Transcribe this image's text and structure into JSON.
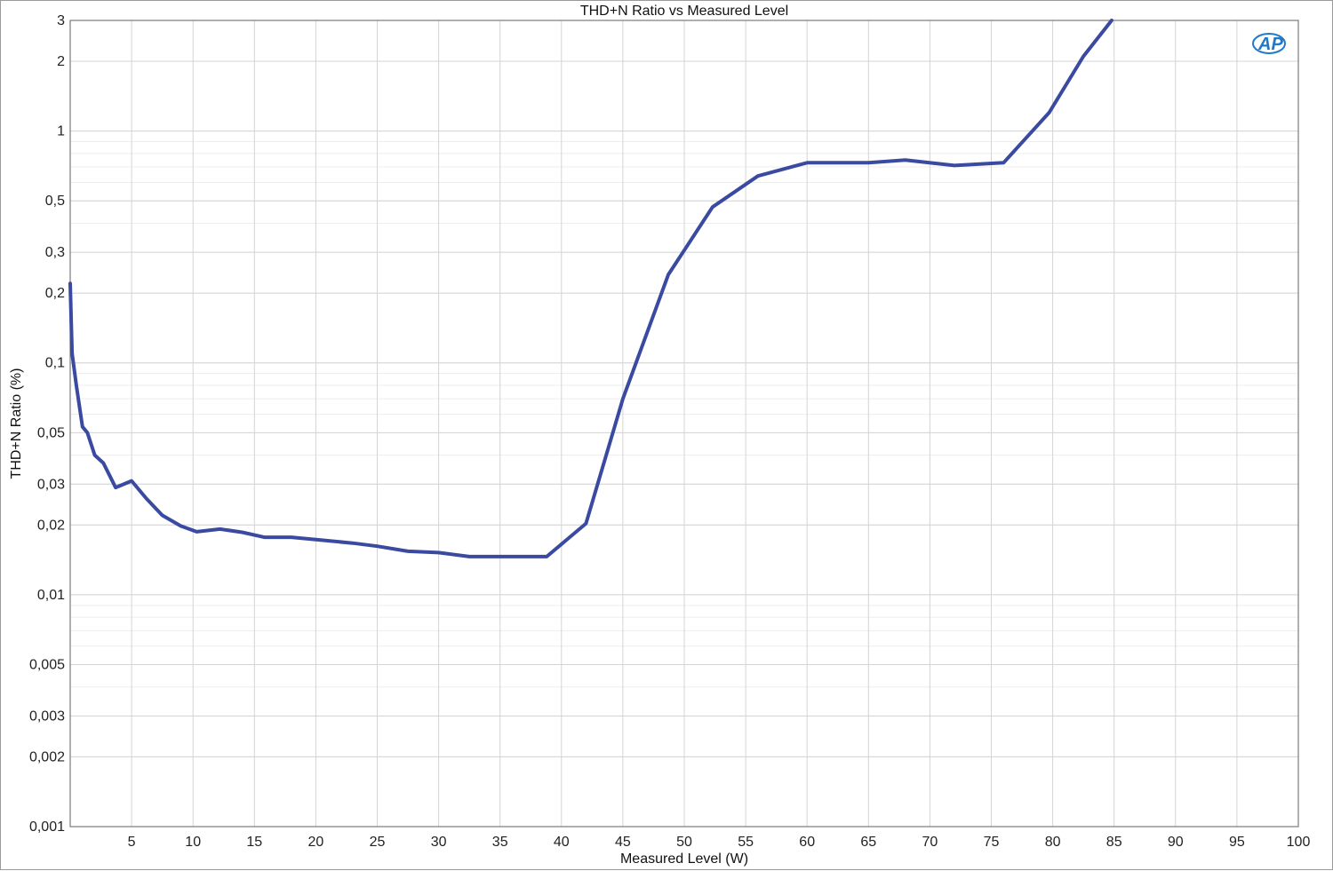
{
  "chart_data": {
    "type": "line",
    "title": "THD+N Ratio vs Measured Level",
    "xlabel": "Measured Level (W)",
    "ylabel": "THD+N Ratio (%)",
    "xlim": [
      0,
      100
    ],
    "ylim": [
      0.001,
      3
    ],
    "yscale": "log",
    "grid": true,
    "x_ticks": [
      5,
      10,
      15,
      20,
      25,
      30,
      35,
      40,
      45,
      50,
      55,
      60,
      65,
      70,
      75,
      80,
      85,
      90,
      95,
      100
    ],
    "y_ticks": [
      {
        "value": 3,
        "label": "3"
      },
      {
        "value": 2,
        "label": "2"
      },
      {
        "value": 1,
        "label": "1"
      },
      {
        "value": 0.5,
        "label": "0,5"
      },
      {
        "value": 0.3,
        "label": "0,3"
      },
      {
        "value": 0.2,
        "label": "0,2"
      },
      {
        "value": 0.1,
        "label": "0,1"
      },
      {
        "value": 0.05,
        "label": "0,05"
      },
      {
        "value": 0.03,
        "label": "0,03"
      },
      {
        "value": 0.02,
        "label": "0,02"
      },
      {
        "value": 0.01,
        "label": "0,01"
      },
      {
        "value": 0.005,
        "label": "0,005"
      },
      {
        "value": 0.003,
        "label": "0,003"
      },
      {
        "value": 0.002,
        "label": "0,002"
      },
      {
        "value": 0.001,
        "label": "0,001"
      }
    ],
    "series": [
      {
        "color": "#3a4aa0",
        "x": [
          0,
          0.15,
          0.5,
          1,
          1.4,
          2,
          2.7,
          3.7,
          5,
          6.2,
          7.5,
          9,
          10.3,
          12.2,
          14,
          15.8,
          18,
          20.5,
          23,
          25,
          27.5,
          30,
          32.5,
          35,
          37.5,
          38.8,
          42,
          45,
          48.7,
          52.3,
          56,
          60,
          65,
          68,
          72,
          76,
          79.7,
          82.5,
          84.8
        ],
        "y": [
          0.22,
          0.11,
          0.08,
          0.053,
          0.05,
          0.04,
          0.037,
          0.029,
          0.031,
          0.026,
          0.022,
          0.0198,
          0.0187,
          0.0192,
          0.0186,
          0.0177,
          0.0177,
          0.0172,
          0.0167,
          0.0162,
          0.0154,
          0.0152,
          0.0146,
          0.0146,
          0.0146,
          0.0146,
          0.0203,
          0.07,
          0.24,
          0.47,
          0.64,
          0.73,
          0.73,
          0.75,
          0.71,
          0.73,
          1.2,
          2.1,
          3.0
        ]
      }
    ]
  },
  "logo": {
    "text": "AP",
    "color": "#1f78c8"
  }
}
